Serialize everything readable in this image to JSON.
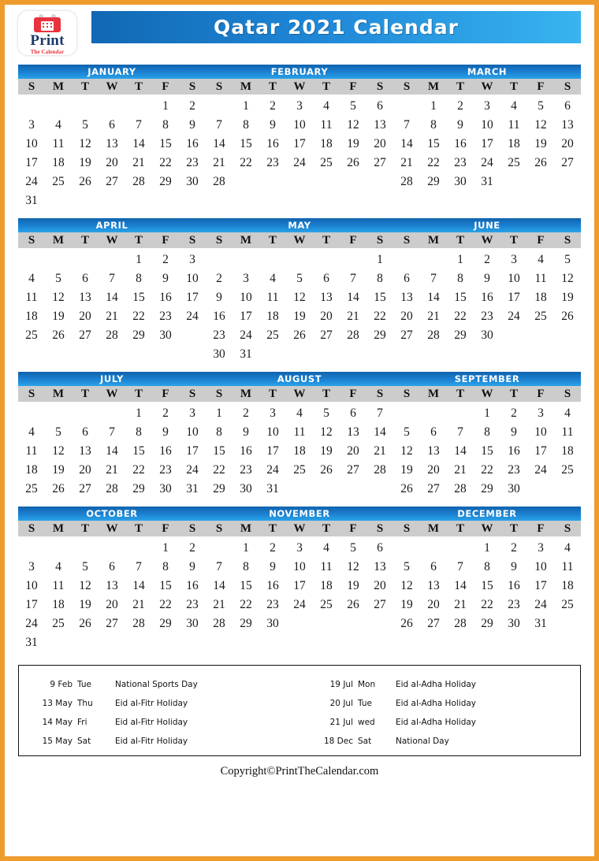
{
  "header": {
    "logo": {
      "word": "Print",
      "subtitle": "The Calendar",
      "icon": "calendar-icon"
    },
    "title": "Qatar 2021 Calendar"
  },
  "colors": {
    "page_border": "#ef9c2e",
    "title_bar_start": "#1168b3",
    "title_bar_end": "#38b4f0",
    "month_bar_start": "#0f63ae",
    "month_bar_end": "#2aa3e8",
    "dow_background": "#cccccc",
    "logo_red": "#e8333f",
    "logo_navy": "#1b3a66"
  },
  "dow_labels": [
    "S",
    "M",
    "T",
    "W",
    "T",
    "F",
    "S"
  ],
  "calendar": {
    "year": "2021",
    "quarters": [
      {
        "months": [
          {
            "name": "JANUARY",
            "weeks": [
              [
                "",
                "",
                "",
                "",
                "",
                "1",
                "2"
              ],
              [
                "3",
                "4",
                "5",
                "6",
                "7",
                "8",
                "9"
              ],
              [
                "10",
                "11",
                "12",
                "13",
                "14",
                "15",
                "16"
              ],
              [
                "17",
                "18",
                "19",
                "20",
                "21",
                "22",
                "23"
              ],
              [
                "24",
                "25",
                "26",
                "27",
                "28",
                "29",
                "30"
              ],
              [
                "31",
                "",
                "",
                "",
                "",
                "",
                ""
              ]
            ]
          },
          {
            "name": "FEBRUARY",
            "weeks": [
              [
                "",
                "1",
                "2",
                "3",
                "4",
                "5",
                "6"
              ],
              [
                "7",
                "8",
                "9",
                "10",
                "11",
                "12",
                "13"
              ],
              [
                "14",
                "15",
                "16",
                "17",
                "18",
                "19",
                "20"
              ],
              [
                "21",
                "22",
                "23",
                "24",
                "25",
                "26",
                "27"
              ],
              [
                "28",
                "",
                "",
                "",
                "",
                "",
                ""
              ],
              [
                "",
                "",
                "",
                "",
                "",
                "",
                ""
              ]
            ]
          },
          {
            "name": "MARCH",
            "weeks": [
              [
                "",
                "1",
                "2",
                "3",
                "4",
                "5",
                "6"
              ],
              [
                "7",
                "8",
                "9",
                "10",
                "11",
                "12",
                "13"
              ],
              [
                "14",
                "15",
                "16",
                "17",
                "18",
                "19",
                "20"
              ],
              [
                "21",
                "22",
                "23",
                "24",
                "25",
                "26",
                "27"
              ],
              [
                "28",
                "29",
                "30",
                "31",
                "",
                "",
                ""
              ],
              [
                "",
                "",
                "",
                "",
                "",
                "",
                ""
              ]
            ]
          }
        ]
      },
      {
        "months": [
          {
            "name": "APRIL",
            "weeks": [
              [
                "",
                "",
                "",
                "",
                "1",
                "2",
                "3"
              ],
              [
                "4",
                "5",
                "6",
                "7",
                "8",
                "9",
                "10"
              ],
              [
                "11",
                "12",
                "13",
                "14",
                "15",
                "16",
                "17"
              ],
              [
                "18",
                "19",
                "20",
                "21",
                "22",
                "23",
                "24"
              ],
              [
                "25",
                "26",
                "27",
                "28",
                "29",
                "30",
                ""
              ],
              [
                "",
                "",
                "",
                "",
                "",
                "",
                ""
              ]
            ]
          },
          {
            "name": "MAY",
            "weeks": [
              [
                "",
                "",
                "",
                "",
                "",
                "",
                "1"
              ],
              [
                "2",
                "3",
                "4",
                "5",
                "6",
                "7",
                "8"
              ],
              [
                "9",
                "10",
                "11",
                "12",
                "13",
                "14",
                "15"
              ],
              [
                "16",
                "17",
                "18",
                "19",
                "20",
                "21",
                "22"
              ],
              [
                "23",
                "24",
                "25",
                "26",
                "27",
                "28",
                "29"
              ],
              [
                "30",
                "31",
                "",
                "",
                "",
                "",
                ""
              ]
            ]
          },
          {
            "name": "JUNE",
            "weeks": [
              [
                "",
                "",
                "1",
                "2",
                "3",
                "4",
                "5"
              ],
              [
                "6",
                "7",
                "8",
                "9",
                "10",
                "11",
                "12"
              ],
              [
                "13",
                "14",
                "15",
                "16",
                "17",
                "18",
                "19"
              ],
              [
                "20",
                "21",
                "22",
                "23",
                "24",
                "25",
                "26"
              ],
              [
                "27",
                "28",
                "29",
                "30",
                "",
                "",
                ""
              ],
              [
                "",
                "",
                "",
                "",
                "",
                "",
                ""
              ]
            ]
          }
        ]
      },
      {
        "months": [
          {
            "name": "JULY",
            "weeks": [
              [
                "",
                "",
                "",
                "",
                "1",
                "2",
                "3"
              ],
              [
                "4",
                "5",
                "6",
                "7",
                "8",
                "9",
                "10"
              ],
              [
                "11",
                "12",
                "13",
                "14",
                "15",
                "16",
                "17"
              ],
              [
                "18",
                "19",
                "20",
                "21",
                "22",
                "23",
                "24"
              ],
              [
                "25",
                "26",
                "27",
                "28",
                "29",
                "30",
                "31"
              ]
            ]
          },
          {
            "name": "AUGUST",
            "weeks": [
              [
                "1",
                "2",
                "3",
                "4",
                "5",
                "6",
                "7"
              ],
              [
                "8",
                "9",
                "10",
                "11",
                "12",
                "13",
                "14"
              ],
              [
                "15",
                "16",
                "17",
                "18",
                "19",
                "20",
                "21"
              ],
              [
                "22",
                "23",
                "24",
                "25",
                "26",
                "27",
                "28"
              ],
              [
                "29",
                "30",
                "31",
                "",
                "",
                "",
                ""
              ]
            ]
          },
          {
            "name": "SEPTEMBER",
            "weeks": [
              [
                "",
                "",
                "",
                "1",
                "2",
                "3",
                "4"
              ],
              [
                "5",
                "6",
                "7",
                "8",
                "9",
                "10",
                "11"
              ],
              [
                "12",
                "13",
                "14",
                "15",
                "16",
                "17",
                "18"
              ],
              [
                "19",
                "20",
                "21",
                "22",
                "23",
                "24",
                "25"
              ],
              [
                "26",
                "27",
                "28",
                "29",
                "30",
                "",
                ""
              ]
            ]
          }
        ]
      },
      {
        "months": [
          {
            "name": "OCTOBER",
            "weeks": [
              [
                "",
                "",
                "",
                "",
                "",
                "1",
                "2"
              ],
              [
                "3",
                "4",
                "5",
                "6",
                "7",
                "8",
                "9"
              ],
              [
                "10",
                "11",
                "12",
                "13",
                "14",
                "15",
                "16"
              ],
              [
                "17",
                "18",
                "19",
                "20",
                "21",
                "22",
                "23"
              ],
              [
                "24",
                "25",
                "26",
                "27",
                "28",
                "29",
                "30"
              ],
              [
                "31",
                "",
                "",
                "",
                "",
                "",
                ""
              ]
            ]
          },
          {
            "name": "NOVEMBER",
            "weeks": [
              [
                "",
                "1",
                "2",
                "3",
                "4",
                "5",
                "6"
              ],
              [
                "7",
                "8",
                "9",
                "10",
                "11",
                "12",
                "13"
              ],
              [
                "14",
                "15",
                "16",
                "17",
                "18",
                "19",
                "20"
              ],
              [
                "21",
                "22",
                "23",
                "24",
                "25",
                "26",
                "27"
              ],
              [
                "28",
                "29",
                "30",
                "",
                "",
                "",
                ""
              ],
              [
                "",
                "",
                "",
                "",
                "",
                "",
                ""
              ]
            ]
          },
          {
            "name": "DECEMBER",
            "weeks": [
              [
                "",
                "",
                "",
                "1",
                "2",
                "3",
                "4"
              ],
              [
                "5",
                "6",
                "7",
                "8",
                "9",
                "10",
                "11"
              ],
              [
                "12",
                "13",
                "14",
                "15",
                "16",
                "17",
                "18"
              ],
              [
                "19",
                "20",
                "21",
                "22",
                "23",
                "24",
                "25"
              ],
              [
                "26",
                "27",
                "28",
                "29",
                "30",
                "31",
                ""
              ],
              [
                "",
                "",
                "",
                "",
                "",
                "",
                ""
              ]
            ]
          }
        ]
      }
    ]
  },
  "holidays": {
    "left": [
      {
        "date": "9 Feb",
        "dow": "Tue",
        "name": "National Sports Day"
      },
      {
        "date": "13 May",
        "dow": "Thu",
        "name": "Eid al-Fitr Holiday"
      },
      {
        "date": "14 May",
        "dow": "Fri",
        "name": "Eid al-Fitr Holiday"
      },
      {
        "date": "15 May",
        "dow": "Sat",
        "name": "Eid al-Fitr Holiday"
      }
    ],
    "right": [
      {
        "date": "19 Jul",
        "dow": "Mon",
        "name": "Eid al-Adha Holiday"
      },
      {
        "date": "20 Jul",
        "dow": "Tue",
        "name": "Eid al-Adha Holiday"
      },
      {
        "date": "21 Jul",
        "dow": "wed",
        "name": "Eid al-Adha Holiday"
      },
      {
        "date": "18 Dec",
        "dow": "Sat",
        "name": "National Day"
      }
    ]
  },
  "footer": {
    "copyright": "Copyright©PrintTheCalendar.com"
  }
}
